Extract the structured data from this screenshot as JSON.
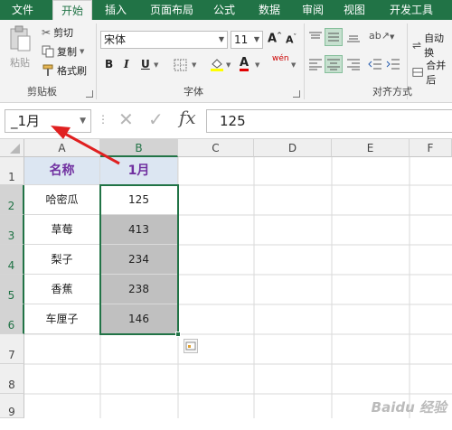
{
  "ribbon_tabs": [
    "文件",
    "开始",
    "插入",
    "页面布局",
    "公式",
    "数据",
    "审阅",
    "视图",
    "开发工具"
  ],
  "clipboard": {
    "paste_label": "粘贴",
    "cut_label": "剪切",
    "copy_label": "复制",
    "format_painter_label": "格式刷",
    "group_label": "剪贴板"
  },
  "font": {
    "font_name": "宋体",
    "font_size": "11",
    "grow_label": "A",
    "shrink_label": "A",
    "bold_label": "B",
    "italic_label": "I",
    "underline_label": "U",
    "font_color_label": "A",
    "phonetic_label": "wén",
    "group_label": "字体"
  },
  "alignment": {
    "wrap_label": "自动换",
    "merge_label": "合并后",
    "group_label": "对齐方式"
  },
  "formula_bar": {
    "name_box": "_1月",
    "formula": "125",
    "fx_label": "fx"
  },
  "columns": [
    "A",
    "B",
    "C",
    "D",
    "E",
    "F"
  ],
  "rows": [
    "1",
    "2",
    "3",
    "4",
    "5",
    "6",
    "7",
    "8",
    "9"
  ],
  "table": {
    "headers": [
      "名称",
      "1月"
    ],
    "rows": [
      [
        "哈密瓜",
        "125"
      ],
      [
        "草莓",
        "413"
      ],
      [
        "梨子",
        "234"
      ],
      [
        "香蕉",
        "238"
      ],
      [
        "车厘子",
        "146"
      ]
    ]
  },
  "watermark": "Baidu 经验",
  "colors": {
    "excel_green": "#217346",
    "header_fill": "#dce6f2",
    "header_text": "#7030a0",
    "arrow_red": "#e02020"
  }
}
